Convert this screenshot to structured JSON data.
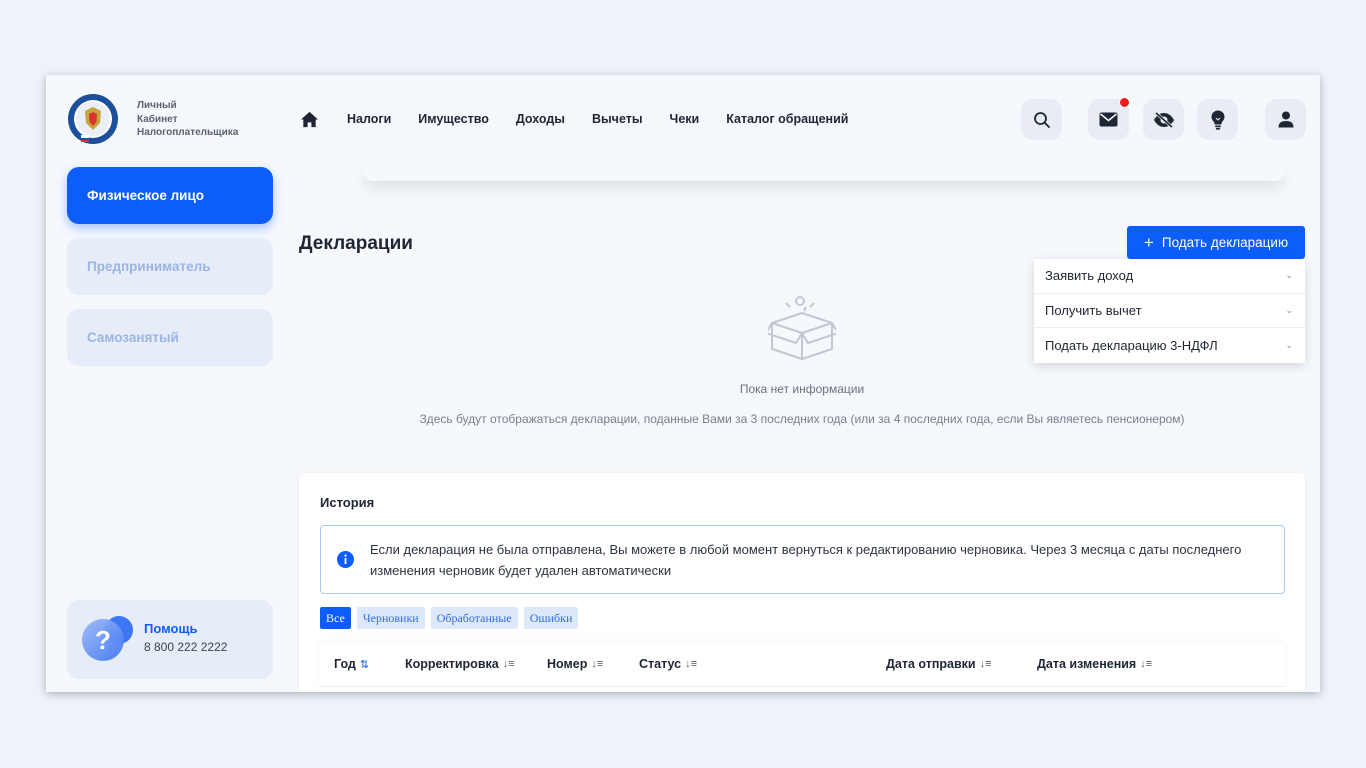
{
  "logo": {
    "lines": [
      "Личный",
      "Кабинет",
      "Налогоплательщика"
    ]
  },
  "sidebar": {
    "items": [
      {
        "label": "Физическое лицо",
        "active": true
      },
      {
        "label": "Предприниматель",
        "active": false
      },
      {
        "label": "Самозанятый",
        "active": false
      }
    ],
    "help": {
      "title": "Помощь",
      "phone": "8 800 222 2222"
    }
  },
  "nav": {
    "items": [
      "Налоги",
      "Имущество",
      "Доходы",
      "Вычеты",
      "Чеки",
      "Каталог обращений"
    ],
    "icons": [
      "home-icon",
      "search-icon",
      "mail-icon",
      "eye-off-icon",
      "bulb-icon",
      "user-icon"
    ],
    "notification_color": "#ef1c1c"
  },
  "main": {
    "title": "Декларации",
    "submit_button": {
      "plus": "+",
      "label": "Подать декларацию"
    },
    "dropdown": [
      "Заявить доход",
      "Получить вычет",
      "Подать декларацию 3-НДФЛ"
    ],
    "empty": {
      "title": "Пока нет информации",
      "description": "Здесь будут отображаться декларации, поданные Вами за 3 последних года (или за 4 последних года, если Вы являетесь пенсионером)"
    }
  },
  "history": {
    "title": "История",
    "info": "Если декларация не была отправлена, Вы можете в любой момент вернуться к редактированию черновика. Через 3 месяца с даты последнего изменения черновик будет удален автоматически",
    "filters": [
      {
        "label": "Все",
        "active": true
      },
      {
        "label": "Черновики",
        "active": false
      },
      {
        "label": "Обработанные",
        "active": false
      },
      {
        "label": "Ошибки",
        "active": false
      }
    ],
    "columns": [
      "Год",
      "Корректировка",
      "Номер",
      "Статус",
      "Дата отправки",
      "Дата изменения"
    ]
  },
  "colors": {
    "accent": "#0d5dfb",
    "background": "#f5f8fd"
  }
}
